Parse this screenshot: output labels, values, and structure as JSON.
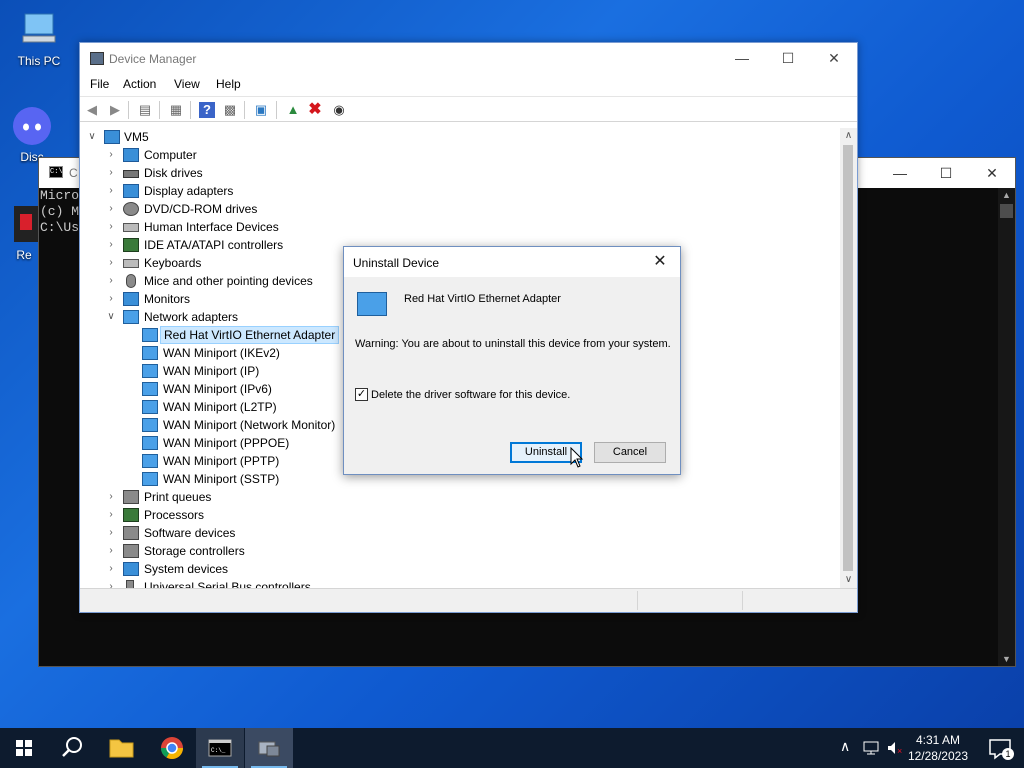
{
  "desktop": {
    "icons": [
      {
        "label": "This PC"
      },
      {
        "label": "Disc"
      },
      {
        "label": "Re"
      }
    ]
  },
  "cmd": {
    "title": "C",
    "lines": [
      "Micro",
      "(c) M",
      "",
      "C:\\Us"
    ]
  },
  "device_manager": {
    "title": "Device Manager",
    "menu": [
      "File",
      "Action",
      "View",
      "Help"
    ],
    "tree": {
      "root": "VM5",
      "categories": [
        {
          "label": "Computer",
          "icon": "computer-icon"
        },
        {
          "label": "Disk drives",
          "icon": "disk-drive-icon"
        },
        {
          "label": "Display adapters",
          "icon": "display-adapter-icon"
        },
        {
          "label": "DVD/CD-ROM drives",
          "icon": "dvd-drive-icon"
        },
        {
          "label": "Human Interface Devices",
          "icon": "hid-icon"
        },
        {
          "label": "IDE ATA/ATAPI controllers",
          "icon": "ide-controller-icon"
        },
        {
          "label": "Keyboards",
          "icon": "keyboard-icon"
        },
        {
          "label": "Mice and other pointing devices",
          "icon": "mouse-icon"
        },
        {
          "label": "Monitors",
          "icon": "monitor-icon"
        },
        {
          "label": "Network adapters",
          "icon": "network-adapter-icon",
          "expanded": true
        }
      ],
      "network_children": [
        "Red Hat VirtIO Ethernet Adapter",
        "WAN Miniport (IKEv2)",
        "WAN Miniport (IP)",
        "WAN Miniport (IPv6)",
        "WAN Miniport (L2TP)",
        "WAN Miniport (Network Monitor)",
        "WAN Miniport (PPPOE)",
        "WAN Miniport (PPTP)",
        "WAN Miniport (SSTP)"
      ],
      "categories_after": [
        {
          "label": "Print queues",
          "icon": "printer-icon"
        },
        {
          "label": "Processors",
          "icon": "processor-icon"
        },
        {
          "label": "Software devices",
          "icon": "software-device-icon"
        },
        {
          "label": "Storage controllers",
          "icon": "storage-controller-icon"
        },
        {
          "label": "System devices",
          "icon": "system-device-icon"
        },
        {
          "label": "Universal Serial Bus controllers",
          "icon": "usb-icon"
        }
      ]
    }
  },
  "dialog": {
    "title": "Uninstall Device",
    "device_name": "Red Hat VirtIO Ethernet Adapter",
    "warning": "Warning: You are about to uninstall this device from your system.",
    "checkbox_label": "Delete the driver software for this device.",
    "checkbox_checked": true,
    "uninstall_label": "Uninstall",
    "cancel_label": "Cancel"
  },
  "taskbar": {
    "time": "4:31 AM",
    "date": "12/28/2023",
    "notification_count": "1"
  }
}
